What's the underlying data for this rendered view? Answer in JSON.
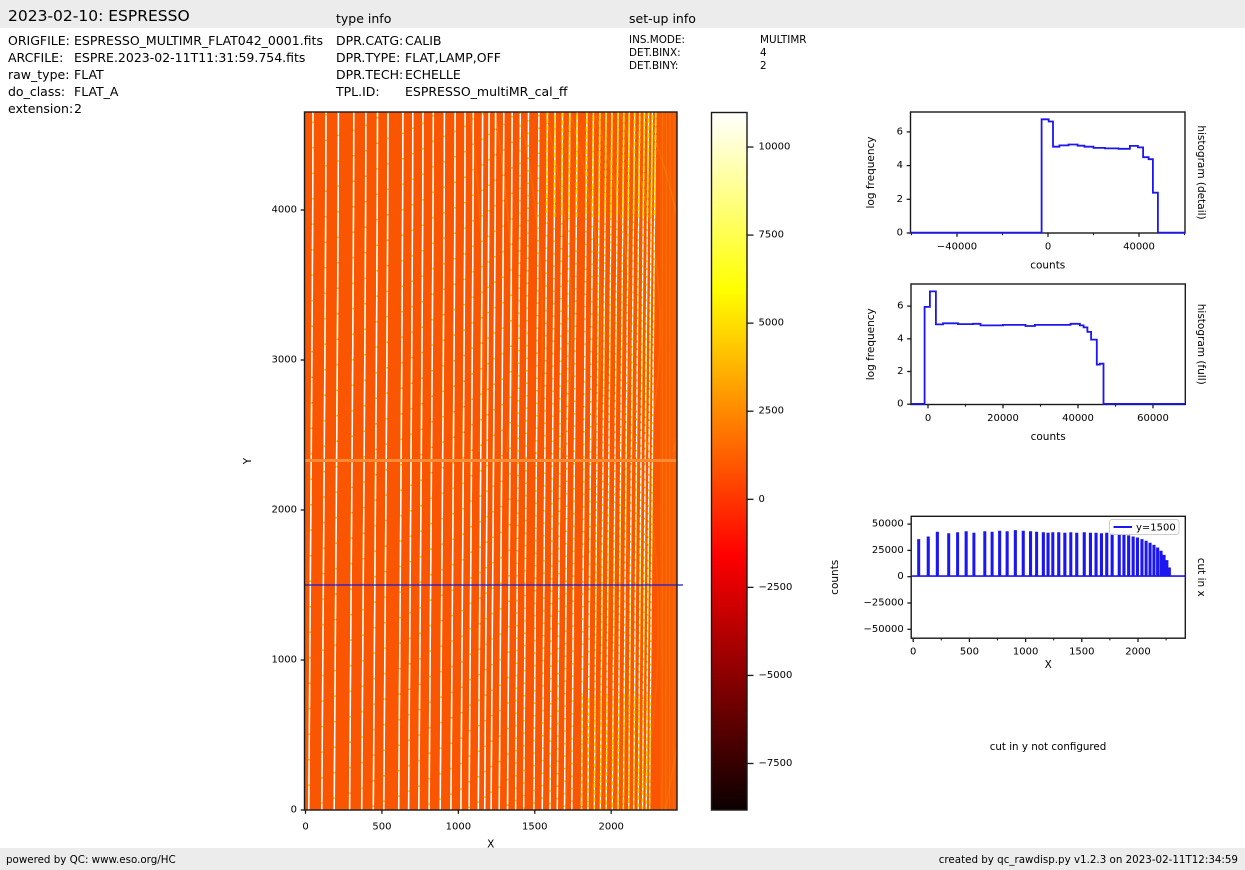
{
  "header": {
    "title": "2023-02-10: ESPRESSO",
    "type_info_label": "type info",
    "setup_info_label": "set-up info"
  },
  "file_info": {
    "rows": [
      {
        "label": "ORIGFILE:",
        "value": "ESPRESSO_MULTIMR_FLAT042_0001.fits"
      },
      {
        "label": "ARCFILE:",
        "value": "ESPRE.2023-02-11T11:31:59.754.fits"
      },
      {
        "label": "raw_type:",
        "value": "FLAT"
      },
      {
        "label": "do_class:",
        "value": "FLAT_A"
      },
      {
        "label": "extension:",
        "value": "2"
      }
    ]
  },
  "type_info": {
    "rows": [
      {
        "label": "DPR.CATG:",
        "value": "CALIB"
      },
      {
        "label": "DPR.TYPE:",
        "value": "FLAT,LAMP,OFF"
      },
      {
        "label": "DPR.TECH:",
        "value": "ECHELLE"
      },
      {
        "label": "TPL.ID:",
        "value": "ESPRESSO_multiMR_cal_ff"
      }
    ]
  },
  "setup_info": {
    "rows": [
      {
        "label": "INS.MODE:",
        "value": "MULTIMR"
      },
      {
        "label": "DET.BINX:",
        "value": "4"
      },
      {
        "label": "DET.BINY:",
        "value": "2"
      }
    ]
  },
  "notes": {
    "cut_in_y": "cut in y not configured"
  },
  "footer": {
    "left": "powered by QC: www.eso.org/HC",
    "right": "created by qc_rawdisp.py v1.2.3 on 2023-02-11T12:34:59"
  },
  "colors": {
    "bar_gray": "#ececec",
    "axis_black": "#1a1a1a",
    "accent_blue": "#1c17ee",
    "image_orange": "#fa5500",
    "stripe_white": "#ffffff",
    "stripe_yellow": "#ffdf00",
    "gap_orange": "#fc8a33",
    "right_band_orange": "#f85d04",
    "legend_border": "#cccccc"
  },
  "chart_data": [
    {
      "id": "raw-image",
      "type": "heatmap",
      "xlabel": "X",
      "ylabel": "Y",
      "xlim": [
        -8,
        2431
      ],
      "ylim": [
        0,
        4653
      ],
      "xticks": [
        0,
        500,
        1000,
        1500,
        2000
      ],
      "yticks": [
        0,
        1000,
        2000,
        3000,
        4000
      ],
      "cut_line_y": 1500,
      "detector_gap_y": 2330,
      "right_band_x": [
        2320,
        2431
      ],
      "background_counts": 1000,
      "order_peak_counts": 45000,
      "order_positions_x": [
        49,
        134,
        215,
        316,
        395,
        471,
        540,
        637,
        702,
        769,
        836,
        909,
        979,
        1044,
        1098,
        1158,
        1200,
        1242,
        1295,
        1349,
        1402,
        1455,
        1522,
        1577,
        1627,
        1675,
        1722,
        1770,
        1833,
        1875,
        1917,
        1957,
        1995,
        2035,
        2072,
        2107,
        2142,
        2175,
        2205,
        2232,
        2257,
        2279
      ],
      "colorbar": {
        "vmin": -8820,
        "vmax": 10980,
        "ticks": [
          10000,
          7500,
          5000,
          2500,
          0,
          -2500,
          -5000,
          -7500
        ],
        "tick_labels": [
          "10000",
          "7500",
          "5000",
          "2500",
          "0",
          "−2500",
          "−5000",
          "−7500"
        ],
        "colormap": "hot",
        "stops": [
          [
            0,
            "#0b0000"
          ],
          [
            0.067,
            "#370000"
          ],
          [
            0.193,
            "#8c0000"
          ],
          [
            0.319,
            "#e00000"
          ],
          [
            0.365,
            "#ff0000"
          ],
          [
            0.446,
            "#ff3600"
          ],
          [
            0.572,
            "#ff8a00"
          ],
          [
            0.698,
            "#ffdf00"
          ],
          [
            0.746,
            "#ffff00"
          ],
          [
            0.824,
            "#ffff4f"
          ],
          [
            0.95,
            "#ffffcd"
          ],
          [
            1,
            "#ffffff"
          ]
        ]
      }
    },
    {
      "id": "histogram-detail",
      "type": "line",
      "line_style": "step",
      "right_label": "histogram (detail)",
      "xlabel": "counts",
      "ylabel": "log frequency",
      "xlim": [
        -60500,
        60200
      ],
      "ylim": [
        0,
        7.18
      ],
      "xticks": [
        -40000,
        0,
        40000
      ],
      "xtick_labels": [
        "−40000",
        "0",
        "40000"
      ],
      "minor_xticks": [
        -60000,
        -20000,
        20000,
        60000
      ],
      "yticks": [
        0,
        2,
        4,
        6
      ],
      "points": [
        [
          -60500,
          0.02
        ],
        [
          -2800,
          0.02
        ],
        [
          -2800,
          6.75
        ],
        [
          300,
          6.75
        ],
        [
          300,
          6.62
        ],
        [
          2200,
          6.62
        ],
        [
          2200,
          5.12
        ],
        [
          5000,
          5.12
        ],
        [
          5000,
          5.2
        ],
        [
          9000,
          5.2
        ],
        [
          9000,
          5.25
        ],
        [
          13000,
          5.25
        ],
        [
          13000,
          5.18
        ],
        [
          16000,
          5.18
        ],
        [
          16000,
          5.12
        ],
        [
          20000,
          5.12
        ],
        [
          20000,
          5.05
        ],
        [
          25000,
          5.05
        ],
        [
          25000,
          5.02
        ],
        [
          31000,
          5.02
        ],
        [
          31000,
          5.0
        ],
        [
          36000,
          5.0
        ],
        [
          36000,
          5.17
        ],
        [
          39500,
          5.17
        ],
        [
          39500,
          5.08
        ],
        [
          41800,
          5.08
        ],
        [
          41800,
          4.5
        ],
        [
          44200,
          4.5
        ],
        [
          44200,
          4.38
        ],
        [
          46100,
          4.38
        ],
        [
          46100,
          2.39
        ],
        [
          48300,
          2.39
        ],
        [
          48300,
          0.02
        ],
        [
          60200,
          0.02
        ]
      ]
    },
    {
      "id": "histogram-full",
      "type": "line",
      "line_style": "step",
      "right_label": "histogram (full)",
      "xlabel": "counts",
      "ylabel": "log frequency",
      "xlim": [
        -4500,
        68500
      ],
      "ylim": [
        0,
        7.34
      ],
      "xticks": [
        0,
        20000,
        40000,
        60000
      ],
      "xtick_labels": [
        "0",
        "20000",
        "40000",
        "60000"
      ],
      "minor_xticks": [
        10000,
        30000,
        50000
      ],
      "yticks": [
        0,
        2,
        4,
        6
      ],
      "points": [
        [
          -4500,
          0.02
        ],
        [
          -900,
          0.02
        ],
        [
          -900,
          5.95
        ],
        [
          500,
          5.95
        ],
        [
          500,
          6.9
        ],
        [
          2100,
          6.9
        ],
        [
          2100,
          4.88
        ],
        [
          4000,
          4.88
        ],
        [
          4000,
          4.95
        ],
        [
          8000,
          4.95
        ],
        [
          8000,
          4.9
        ],
        [
          12000,
          4.9
        ],
        [
          12000,
          4.92
        ],
        [
          14000,
          4.92
        ],
        [
          14000,
          4.82
        ],
        [
          20000,
          4.82
        ],
        [
          20000,
          4.85
        ],
        [
          26000,
          4.85
        ],
        [
          26000,
          4.78
        ],
        [
          28500,
          4.78
        ],
        [
          28500,
          4.85
        ],
        [
          38000,
          4.85
        ],
        [
          38000,
          4.92
        ],
        [
          40500,
          4.92
        ],
        [
          40500,
          4.82
        ],
        [
          41500,
          4.82
        ],
        [
          41500,
          4.7
        ],
        [
          42500,
          4.7
        ],
        [
          42500,
          4.42
        ],
        [
          43500,
          4.42
        ],
        [
          43500,
          3.95
        ],
        [
          45000,
          3.95
        ],
        [
          45000,
          2.42
        ],
        [
          45800,
          2.42
        ],
        [
          45800,
          2.48
        ],
        [
          46800,
          2.48
        ],
        [
          46800,
          0.02
        ],
        [
          68500,
          0.02
        ]
      ]
    },
    {
      "id": "cut-in-x",
      "type": "line",
      "right_label": "cut in x",
      "xlabel": "X",
      "ylabel": "counts",
      "legend": [
        {
          "label": "y=1500",
          "color": "#1c17ee"
        }
      ],
      "xlim": [
        -18,
        2421
      ],
      "ylim": [
        -58500,
        57400
      ],
      "xticks": [
        0,
        500,
        1000,
        1500,
        2000
      ],
      "xtick_labels": [
        "0",
        "500",
        "1000",
        "1500",
        "2000"
      ],
      "minor_xticks": [
        250,
        750,
        1250,
        1750,
        2250
      ],
      "yticks": [
        50000,
        25000,
        0,
        -25000,
        -50000
      ],
      "ytick_labels": [
        "50000",
        "25000",
        "0",
        "−25000",
        "−50000"
      ],
      "baseline_counts": 600,
      "spike_x": [
        49,
        134,
        215,
        316,
        395,
        471,
        540,
        637,
        702,
        769,
        836,
        909,
        979,
        1044,
        1098,
        1158,
        1200,
        1242,
        1295,
        1349,
        1402,
        1455,
        1522,
        1577,
        1627,
        1675,
        1722,
        1770,
        1833,
        1875,
        1917,
        1957,
        1995,
        2035,
        2072,
        2107,
        2142,
        2175,
        2205,
        2232,
        2257,
        2279
      ],
      "spike_heights": [
        35000,
        37500,
        42000,
        40500,
        41500,
        42500,
        41000,
        42500,
        42000,
        43000,
        42500,
        43500,
        43000,
        42500,
        42000,
        41500,
        41000,
        41500,
        41500,
        41000,
        41500,
        41000,
        41500,
        41000,
        41000,
        40500,
        41000,
        40500,
        40000,
        39500,
        38500,
        37500,
        36500,
        35000,
        33500,
        31500,
        29500,
        27000,
        24000,
        20000,
        15000,
        8000
      ]
    }
  ]
}
